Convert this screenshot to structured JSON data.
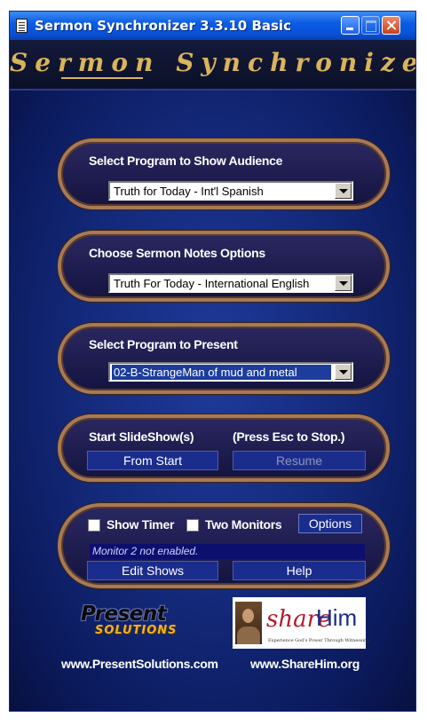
{
  "window": {
    "title": "Sermon Synchronizer 3.3.10 Basic",
    "banner": "Sermon Synchronizer",
    "accent_color": "#d9b45a"
  },
  "audience": {
    "label": "Select Program to Show Audience",
    "selected": "Truth for Today - Int'l Spanish"
  },
  "notes": {
    "label": "Choose Sermon Notes Options",
    "selected": "Truth For Today - International English"
  },
  "present": {
    "label": "Select Program to Present",
    "selected": "02-B-StrangeMan of mud and metal"
  },
  "slideshow": {
    "label": "Start SlideShow(s)",
    "hint": "(Press Esc to Stop.)",
    "from_start": "From Start",
    "resume": "Resume"
  },
  "options_panel": {
    "show_timer": "Show Timer",
    "two_monitors": "Two Monitors",
    "options": "Options",
    "status": "Monitor 2 not enabled.",
    "edit_shows": "Edit Shows",
    "help": "Help"
  },
  "logos": {
    "present_line1": "Present",
    "present_line2": "SOLUTIONS",
    "present_url": "www.PresentSolutions.com",
    "sharehim_share": "share",
    "sharehim_him": "Him",
    "sharehim_tagline": "Experience God's Power Through Witnessing",
    "sharehim_url": "www.ShareHim.org"
  }
}
